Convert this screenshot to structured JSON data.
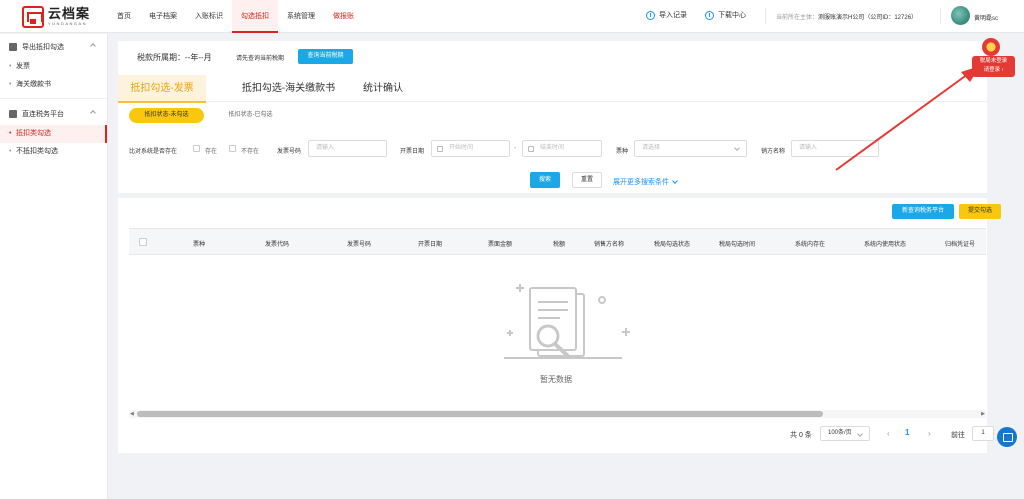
{
  "header": {
    "logo_cn": "云档案",
    "logo_en": "YUNDANGAN",
    "nav": [
      "首页",
      "电子档案",
      "入账标识",
      "勾选抵扣",
      "系统管理",
      "做报账"
    ],
    "import_label": "导入记录",
    "download_label": "下载中心",
    "company_prefix": "当前所在主体：",
    "company_name": "测服账演示H公司（公司ID：12726）",
    "user_name": "黄明磊sc"
  },
  "sidebar": {
    "group1": "导出抵扣勾选",
    "group1_items": [
      "发票",
      "海关缴款书"
    ],
    "group2": "直连税务平台",
    "group2_items": [
      "抵扣类勾选",
      "不抵扣类勾选"
    ]
  },
  "period": {
    "label": "税款所属期：--年--月",
    "hint": "请先查询当前税期",
    "button": "查询当前税期"
  },
  "tabs": [
    "抵扣勾选-发票",
    "抵扣勾选-海关缴款书",
    "统计确认"
  ],
  "status_pills": [
    "抵扣状态-未勾选",
    "抵扣状态-已勾选"
  ],
  "filters": {
    "compare_label": "比对系统是否存在",
    "exists": "存在",
    "not_exists": "不存在",
    "invoice_no_label": "发票号码",
    "invoice_no_placeholder": "请输入",
    "date_label": "开票日期",
    "start_placeholder": "开始时间",
    "range_sep": "-",
    "end_placeholder": "结束时间",
    "type_label": "票种",
    "type_placeholder": "请选择",
    "seller_label": "销方名称",
    "seller_placeholder": "请输入",
    "search_btn": "搜索",
    "reset_btn": "重置",
    "expand_label": "展开更多搜索条件"
  },
  "actions": {
    "sync_btn": "新查询税务平台",
    "submit_btn": "提交勾选"
  },
  "table": {
    "columns": [
      "票种",
      "发票代码",
      "发票号码",
      "开票日期",
      "票面金额",
      "税额",
      "销售方名称",
      "税局勾选状态",
      "税局勾选时间",
      "系统内存在",
      "系统内使用状态",
      "归档凭证号"
    ],
    "empty_text": "暂无数据"
  },
  "pagination": {
    "total": "共 0 条",
    "page_size": "100条/页",
    "current": "1",
    "goto_label": "前往",
    "goto_value": "1"
  },
  "tax_badge": {
    "line1": "税局未登录",
    "line2": "请登录 ›"
  }
}
